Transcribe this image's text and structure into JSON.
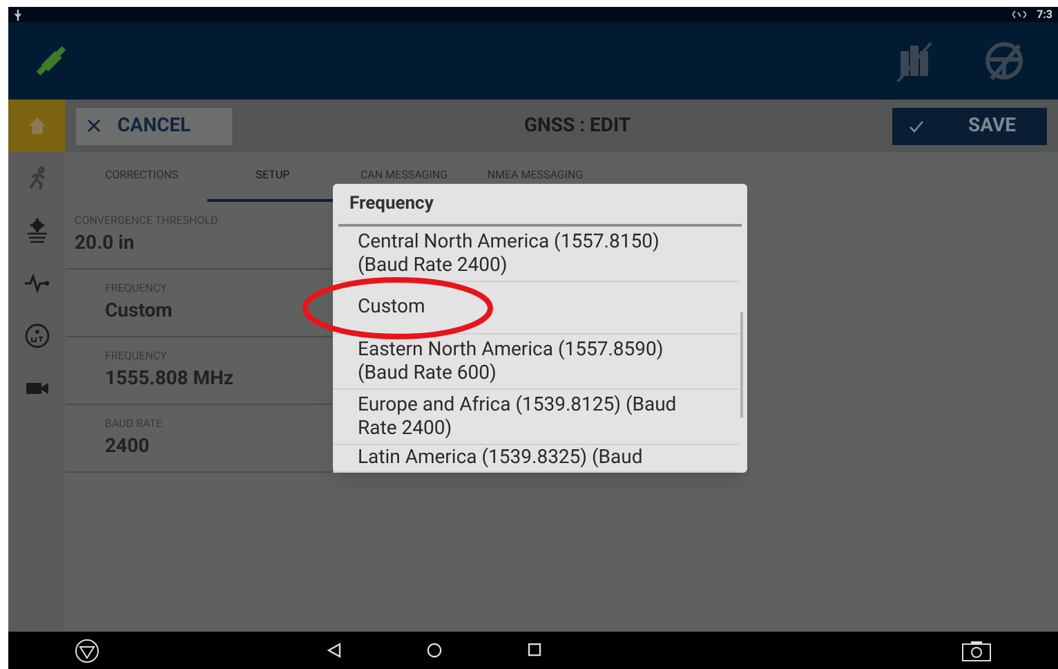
{
  "status_bar": {
    "time": "7:3"
  },
  "toolbar": {
    "cancel": "CANCEL",
    "title": "GNSS : EDIT",
    "save": "SAVE"
  },
  "sidebar": {
    "items": [
      {
        "selected": true
      },
      {
        "selected": false
      },
      {
        "selected": false
      },
      {
        "selected": false
      },
      {
        "selected": false
      },
      {
        "selected": false
      }
    ]
  },
  "tabs": [
    {
      "label": "CORRECTIONS",
      "selected": false
    },
    {
      "label": "SETUP",
      "selected": true
    },
    {
      "label": "CAN MESSAGING",
      "selected": false
    },
    {
      "label": "NMEA MESSAGING",
      "selected": false
    }
  ],
  "fields": [
    {
      "label": "CONVERGENCE THRESHOLD",
      "value": "20.0 in",
      "indented": false
    },
    {
      "label": "FREQUENCY",
      "value": "Custom",
      "indented": true
    },
    {
      "label": "FREQUENCY",
      "value": "1555.808 MHz",
      "indented": true
    },
    {
      "label": "BAUD RATE",
      "value": "2400",
      "indented": true
    }
  ],
  "dialog": {
    "title": "Frequency",
    "options": [
      {
        "text": "Central North America (1557.8150) (Baud Rate 2400)",
        "circled": false
      },
      {
        "text": "Custom",
        "circled": true
      },
      {
        "text": "Eastern North America (1557.8590) (Baud Rate 600)",
        "circled": false
      },
      {
        "text": "Europe and Africa (1539.8125) (Baud Rate 2400)",
        "circled": false
      },
      {
        "text": "Latin America (1539.8325) (Baud",
        "circled": false
      }
    ]
  }
}
